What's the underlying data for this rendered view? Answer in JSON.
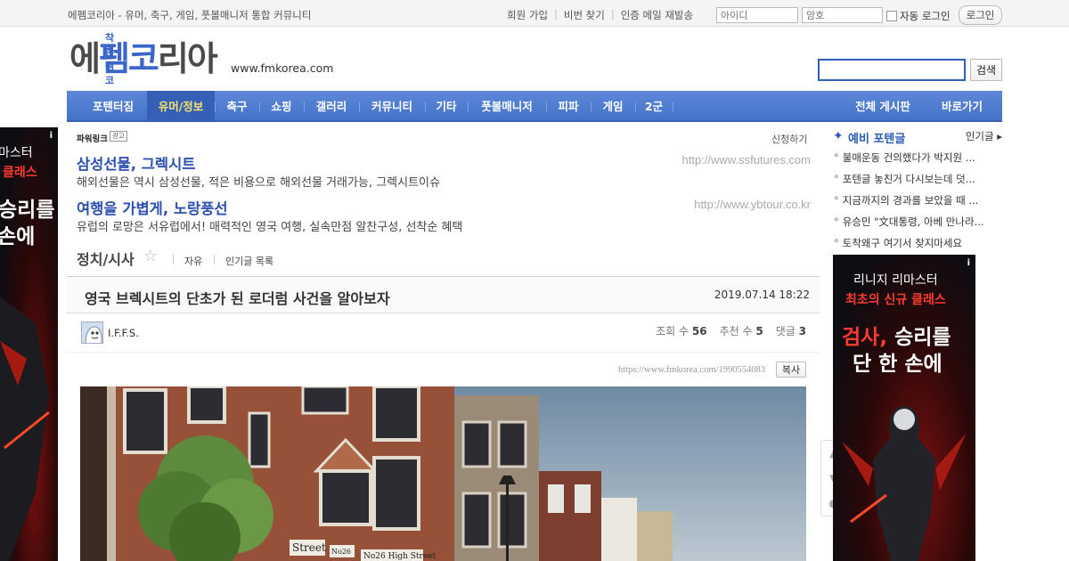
{
  "topbar": {
    "tagline": "에펨코리아 - 유머, 축구, 게임, 풋볼매니저 통합 커뮤니티",
    "links": [
      "회원 가입",
      "비번 찾기",
      "인증 메일 재발송"
    ],
    "id_placeholder": "아이디",
    "pw_placeholder": "암호",
    "auto_login": "자동 로그인",
    "login_button": "로그인"
  },
  "logo": {
    "sub": "착한 펨코",
    "main_a": "에",
    "main_b": "펨코",
    "main_c": "리아",
    "url": "www.fmkorea.com"
  },
  "search": {
    "button": "검색"
  },
  "nav": {
    "items": [
      "포텐터짐",
      "유머/정보",
      "축구",
      "쇼핑",
      "갤러리",
      "커뮤니티",
      "기타",
      "풋볼매니저",
      "피파",
      "게임",
      "2군"
    ],
    "active": "유머/정보",
    "right_items": [
      "전체 게시판",
      "바로가기"
    ]
  },
  "powerlink": {
    "label": "파워링크",
    "ad_tag": "광고",
    "apply": "신청하기",
    "ads": [
      {
        "title": "삼성선물, 그렉시트",
        "url": "http://www.ssfutures.com",
        "desc": "해외선물은 역시 삼성선물, 적은 비용으로 해외선물 거래가능, 그렉시트이슈"
      },
      {
        "title": "여행을 가볍게, 노랑풍선",
        "url": "http://www.ybtour.co.kr",
        "desc": "유럽의 로망은 서유럽에서! 매력적인 영국 여행, 실속만점 알찬구성, 선착순 혜택"
      }
    ]
  },
  "board": {
    "title": "정치/시사",
    "links": [
      "자유",
      "인기글 목록"
    ]
  },
  "post": {
    "title": "영국 브렉시트의 단초가 된 로더럼 사건을 알아보자",
    "date": "2019.07.14 18:22",
    "author": "I.F.F.S.",
    "views_label": "조회 수",
    "views": "56",
    "likes_label": "추천 수",
    "likes": "5",
    "comments_label": "댓글",
    "comments": "3",
    "url": "https://www.fmkorea.com/1990554083",
    "copy": "복사",
    "photo_signs": [
      "Street",
      "No26 High Street",
      "No26"
    ]
  },
  "sidebar": {
    "title": "예비 포텐글",
    "more": "인기글",
    "items": [
      "불매운동 건의했다가 박지원 ...",
      "포텐글 놓친거 다시보는데 덧...",
      "지금까지의 경과를 보았을 때 ...",
      "유승민 \"文대통령, 아베 만나라...",
      "토착왜구 여기서 찾지마세요"
    ]
  },
  "banner_right": {
    "line1": "리니지 리마스터",
    "line2": "최초의 신규 클래스",
    "line3a": "검사,",
    "line3b": "승리를",
    "line4": "단 한 손에"
  },
  "banner_left": {
    "line1": "마스터",
    "line2": "클래스",
    "line3": "승리를",
    "line4": "손에"
  },
  "colors": {
    "nav_blue": "#4a78cf",
    "link_blue": "#2c4fb0",
    "active_nav_text": "#f5e36a"
  }
}
